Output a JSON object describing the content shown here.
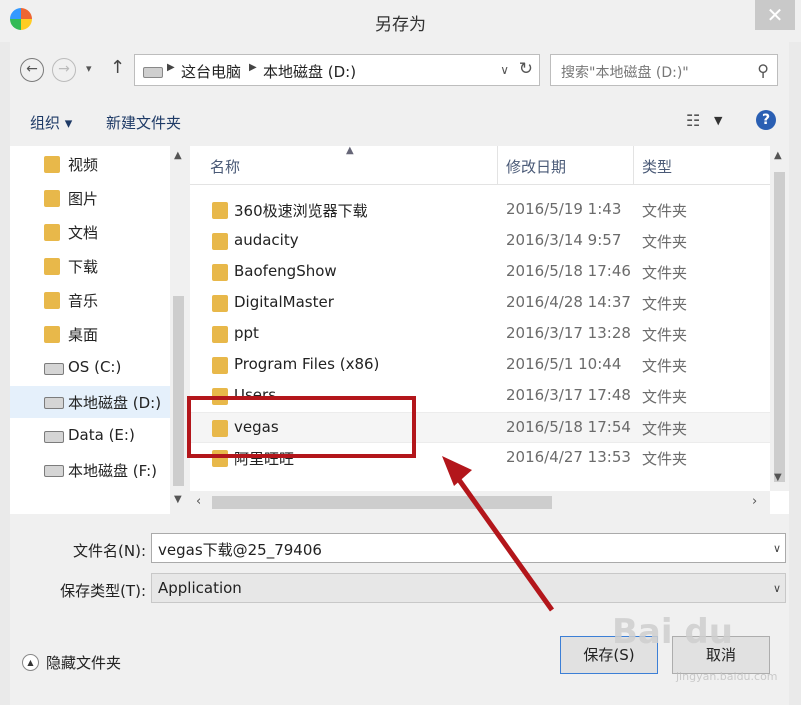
{
  "window": {
    "title": "另存为",
    "close_glyph": "✕"
  },
  "nav": {
    "back_glyph": "←",
    "forward_glyph": "→",
    "dropdown_glyph": "▾",
    "up_glyph": "↑",
    "breadcrumbs": [
      "这台电脑",
      "本地磁盘 (D:)"
    ],
    "refresh_glyph": "↻",
    "search_placeholder": "搜索\"本地磁盘 (D:)\""
  },
  "toolbar": {
    "organize": "组织 ▾",
    "new_folder": "新建文件夹",
    "view_glyph": "☷",
    "help_glyph": "?"
  },
  "sidebar": {
    "items": [
      {
        "label": "视频",
        "icon": "folder-icon"
      },
      {
        "label": "图片",
        "icon": "folder-icon"
      },
      {
        "label": "文档",
        "icon": "folder-icon"
      },
      {
        "label": "下载",
        "icon": "folder-icon"
      },
      {
        "label": "音乐",
        "icon": "folder-icon"
      },
      {
        "label": "桌面",
        "icon": "folder-icon"
      },
      {
        "label": "OS (C:)",
        "icon": "drive-icon"
      },
      {
        "label": "本地磁盘 (D:)",
        "icon": "drive-icon",
        "selected": true
      },
      {
        "label": "Data (E:)",
        "icon": "drive-icon"
      },
      {
        "label": "本地磁盘 (F:)",
        "icon": "drive-icon"
      }
    ]
  },
  "filelist": {
    "columns": [
      "名称",
      "修改日期",
      "类型"
    ],
    "rows": [
      {
        "name": "360极速浏览器下载",
        "date": "2016/5/19 1:43",
        "type": "文件夹"
      },
      {
        "name": "audacity",
        "date": "2016/3/14 9:57",
        "type": "文件夹"
      },
      {
        "name": "BaofengShow",
        "date": "2016/5/18 17:46",
        "type": "文件夹"
      },
      {
        "name": "DigitalMaster",
        "date": "2016/4/28 14:37",
        "type": "文件夹"
      },
      {
        "name": "ppt",
        "date": "2016/3/17 13:28",
        "type": "文件夹"
      },
      {
        "name": "Program Files (x86)",
        "date": "2016/5/1 10:44",
        "type": "文件夹"
      },
      {
        "name": "Users",
        "date": "2016/3/17 17:48",
        "type": "文件夹"
      },
      {
        "name": "vegas",
        "date": "2016/5/18 17:54",
        "type": "文件夹"
      },
      {
        "name": "阿里旺旺",
        "date": "2016/4/27 13:53",
        "type": "文件夹"
      }
    ]
  },
  "form": {
    "filename_label": "文件名(N):",
    "filename_value": "vegas下载@25_79406",
    "filetype_label": "保存类型(T):",
    "filetype_value": "Application"
  },
  "footer": {
    "hide_folders": "隐藏文件夹",
    "save": "保存(S)",
    "cancel": "取消"
  },
  "watermark": {
    "text": "Bai du",
    "sub": "jingyan.baidu.com"
  },
  "colors": {
    "annotation": "#b3161b",
    "folder": "#e8b84a",
    "link": "#1e3a66"
  }
}
